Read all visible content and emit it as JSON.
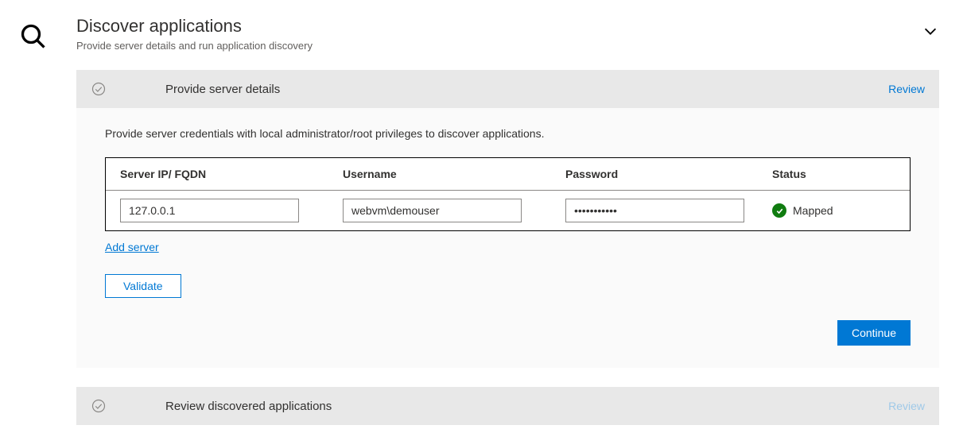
{
  "header": {
    "title": "Discover applications",
    "subtitle": "Provide server details and run application discovery"
  },
  "section1": {
    "title": "Provide server details",
    "review": "Review",
    "description": "Provide server credentials with local administrator/root privileges to discover applications.",
    "columns": {
      "ip": "Server IP/ FQDN",
      "username": "Username",
      "password": "Password",
      "status": "Status"
    },
    "row": {
      "ip": "127.0.0.1",
      "username": "webvm\\demouser",
      "password": "•••••••••••",
      "status": "Mapped"
    },
    "add_server": "Add server",
    "validate": "Validate",
    "continue": "Continue"
  },
  "section2": {
    "title": "Review discovered applications",
    "review": "Review"
  }
}
